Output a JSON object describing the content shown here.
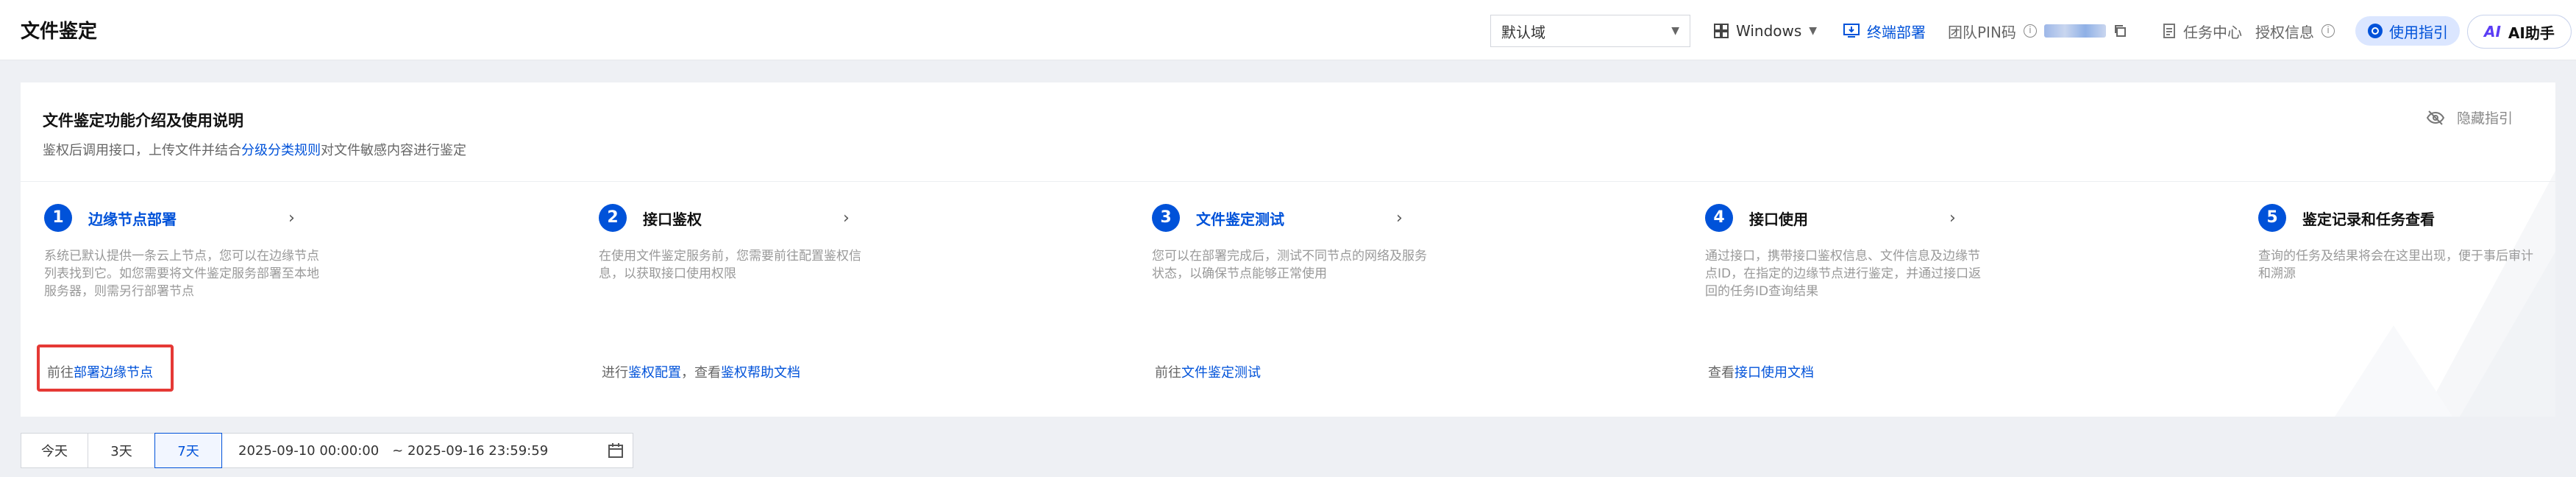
{
  "header": {
    "title": "文件鉴定",
    "domain_select": "默认域",
    "os_label": "Windows",
    "deploy_label": "终端部署",
    "pin_label": "团队PIN码",
    "task_center": "任务中心",
    "auth_info": "授权信息",
    "guide_label": "使用指引",
    "ai_badge": "AI",
    "ai_label": "AI助手"
  },
  "intro": {
    "title": "文件鉴定功能介绍及使用说明",
    "desc_prefix": "鉴权后调用接口，上传文件并结合",
    "desc_link": "分级分类规则",
    "desc_suffix": "对文件敏感内容进行鉴定",
    "hide_label": "隐藏指引",
    "steps": [
      {
        "num": "1",
        "title": "边缘节点部署",
        "desc": "系统已默认提供一条云上节点，您可以在边缘节点列表找到它。如您需要将文件鉴定服务部署至本地服务器，则需另行部署节点",
        "action_prefix": "前往",
        "action_link": "部署边缘节点"
      },
      {
        "num": "2",
        "title": "接口鉴权",
        "desc": "在使用文件鉴定服务前，您需要前往配置鉴权信息，以获取接口使用权限",
        "action_prefix": "进行",
        "action_link": "鉴权配置",
        "action_mid": "，查看",
        "action_link2": "鉴权帮助文档"
      },
      {
        "num": "3",
        "title": "文件鉴定测试",
        "desc": "您可以在部署完成后，测试不同节点的网络及服务状态，以确保节点能够正常使用",
        "action_prefix": "前往",
        "action_link": "文件鉴定测试"
      },
      {
        "num": "4",
        "title": "接口使用",
        "desc": "通过接口，携带接口鉴权信息、文件信息及边缘节点ID，在指定的边缘节点进行鉴定，并通过接口返回的任务ID查询结果",
        "action_prefix": "查看",
        "action_link": "接口使用文档"
      },
      {
        "num": "5",
        "title": "鉴定记录和任务查看",
        "desc": "查询的任务及结果将会在这里出现，便于事后审计和溯源"
      }
    ]
  },
  "datebar": {
    "today": "今天",
    "three_days": "3天",
    "seven_days": "7天",
    "start": "2025-09-10 00:00:00",
    "end": "~ 2025-09-16 23:59:59"
  },
  "colors": {
    "accent": "#0052d9",
    "highlight_box": "#e53935"
  }
}
